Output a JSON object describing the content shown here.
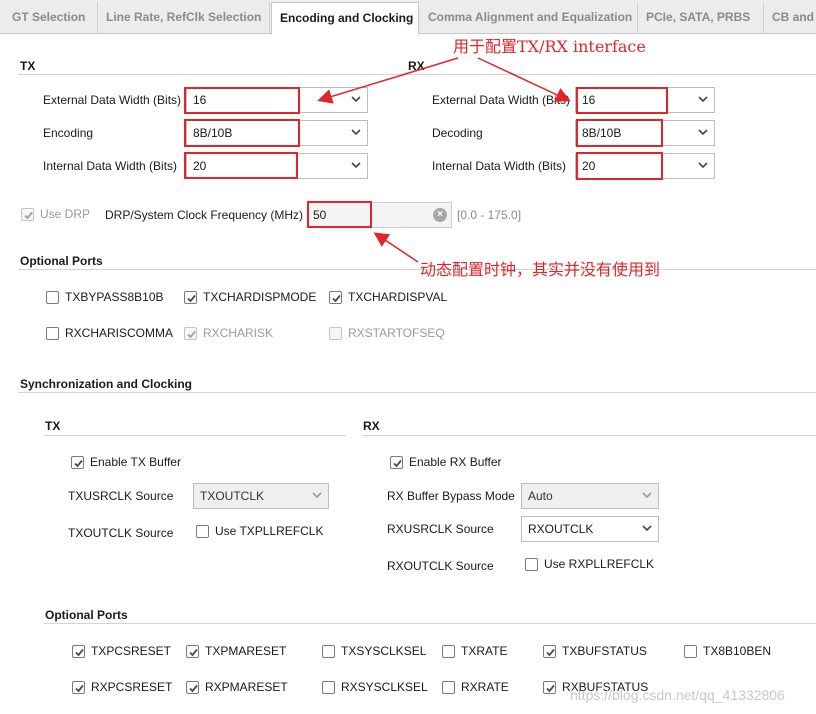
{
  "tabs": [
    {
      "label": "GT Selection"
    },
    {
      "label": "Line Rate, RefClk Selection"
    },
    {
      "label": "Encoding and Clocking"
    },
    {
      "label": "Comma Alignment and Equalization"
    },
    {
      "label": "PCIe, SATA, PRBS"
    },
    {
      "label": "CB and"
    }
  ],
  "active_tab": "Encoding and Clocking",
  "encoding": {
    "tx_header": "TX",
    "rx_header": "RX",
    "tx": {
      "external_width_label": "External Data Width (Bits)",
      "external_width_value": "16",
      "encoding_label": "Encoding",
      "encoding_value": "8B/10B",
      "internal_width_label": "Internal Data Width (Bits)",
      "internal_width_value": "20"
    },
    "rx": {
      "external_width_label": "External Data Width (Bits)",
      "external_width_value": "16",
      "decoding_label": "Decoding",
      "decoding_value": "8B/10B",
      "internal_width_label": "Internal Data Width (Bits)",
      "internal_width_value": "20"
    }
  },
  "drp": {
    "use_drp_label": "Use DRP",
    "use_drp_checked": true,
    "freq_label": "DRP/System Clock Frequency (MHz)",
    "freq_value": "50",
    "range": "[0.0 - 175.0]"
  },
  "optional_ports_1": {
    "title": "Optional Ports",
    "items": [
      {
        "label": "TXBYPASS8B10B",
        "checked": false,
        "disabled": false
      },
      {
        "label": "TXCHARDISPMODE",
        "checked": true,
        "disabled": false
      },
      {
        "label": "TXCHARDISPVAL",
        "checked": true,
        "disabled": false
      },
      {
        "label": "RXCHARISCOMMA",
        "checked": false,
        "disabled": false
      },
      {
        "label": "RXCHARISK",
        "checked": true,
        "disabled": true
      },
      {
        "label": "RXSTARTOFSEQ",
        "checked": false,
        "disabled": true
      }
    ]
  },
  "sync": {
    "title": "Synchronization and Clocking",
    "tx_header": "TX",
    "rx_header": "RX",
    "tx": {
      "enable_buffer_label": "Enable TX Buffer",
      "usrclk_label": "TXUSRCLK Source",
      "usrclk_value": "TXOUTCLK",
      "outclk_label": "TXOUTCLK Source",
      "use_pll_label": "Use TXPLLREFCLK"
    },
    "rx": {
      "enable_buffer_label": "Enable RX Buffer",
      "bypass_label": "RX Buffer Bypass Mode",
      "bypass_value": "Auto",
      "usrclk_label": "RXUSRCLK Source",
      "usrclk_value": "RXOUTCLK",
      "outclk_label": "RXOUTCLK Source",
      "use_pll_label": "Use RXPLLREFCLK"
    }
  },
  "optional_ports_2": {
    "title": "Optional Ports",
    "row1": [
      {
        "label": "TXPCSRESET",
        "checked": true
      },
      {
        "label": "TXPMARESET",
        "checked": true
      },
      {
        "label": "TXSYSCLKSEL",
        "checked": false
      },
      {
        "label": "TXRATE",
        "checked": false
      },
      {
        "label": "TXBUFSTATUS",
        "checked": true
      },
      {
        "label": "TX8B10BEN",
        "checked": false
      }
    ],
    "row2": [
      {
        "label": "RXPCSRESET",
        "checked": true
      },
      {
        "label": "RXPMARESET",
        "checked": true
      },
      {
        "label": "RXSYSCLKSEL",
        "checked": false
      },
      {
        "label": "RXRATE",
        "checked": false
      },
      {
        "label": "RXBUFSTATUS",
        "checked": true
      }
    ]
  },
  "annotations": {
    "top": "用于配置TX/RX interface",
    "drp": "动态配置时钟，其实并没有使用到"
  },
  "watermark": "https://blog.csdn.net/qq_41332806",
  "colors": {
    "annotation_red": "#e0262a",
    "check_gray": "#4a4a4a"
  }
}
